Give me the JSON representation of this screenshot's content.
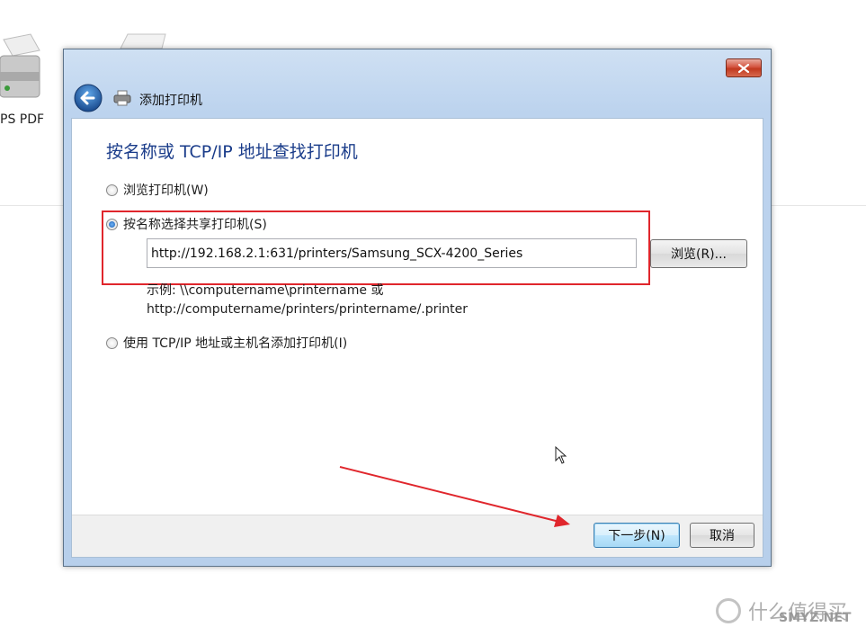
{
  "background": {
    "icon_label_partial": "PS PDF"
  },
  "dialog": {
    "title": "添加打印机",
    "heading": "按名称或 TCP/IP 地址查找打印机",
    "options": [
      {
        "label": "浏览打印机(W)",
        "checked": false
      },
      {
        "label": "按名称选择共享打印机(S)",
        "checked": true
      },
      {
        "label": "使用 TCP/IP 地址或主机名添加打印机(I)",
        "checked": false
      }
    ],
    "url_value": "http://192.168.2.1:631/printers/Samsung_SCX-4200_Series",
    "browse_label": "浏览(R)...",
    "example_line1": "示例: \\\\computername\\printername 或",
    "example_line2": "http://computername/printers/printername/.printer",
    "next_label": "下一步(N)",
    "cancel_label": "取消"
  },
  "watermark": {
    "text": "什么值得买",
    "site": "SMYZ.NET"
  },
  "colors": {
    "heading": "#1a3c8a",
    "highlight": "#e0262c",
    "annotation_arrow": "#e0262c"
  },
  "icons": [
    "printer-icon",
    "back-arrow-icon",
    "close-icon",
    "mouse-cursor-icon"
  ]
}
